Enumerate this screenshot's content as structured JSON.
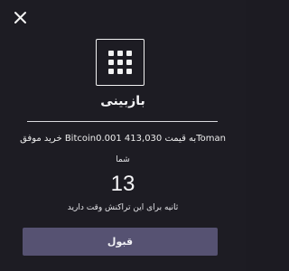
{
  "modal": {
    "title": "بازبینی",
    "description": "خرید موفق Bitcoin0.001 به قیمت 413,030Toman",
    "your_label": "شما",
    "countdown_seconds": "13",
    "countdown_text": "ثانیه برای این تراکنش وقت دارید",
    "accept_label": "قبول"
  },
  "icons": {
    "close": "close-icon",
    "logo": "grid-logo-icon"
  },
  "colors": {
    "background": "#1d1c23",
    "button": "#565272",
    "text": "#f4f4f6",
    "divider": "#d9d9de"
  }
}
